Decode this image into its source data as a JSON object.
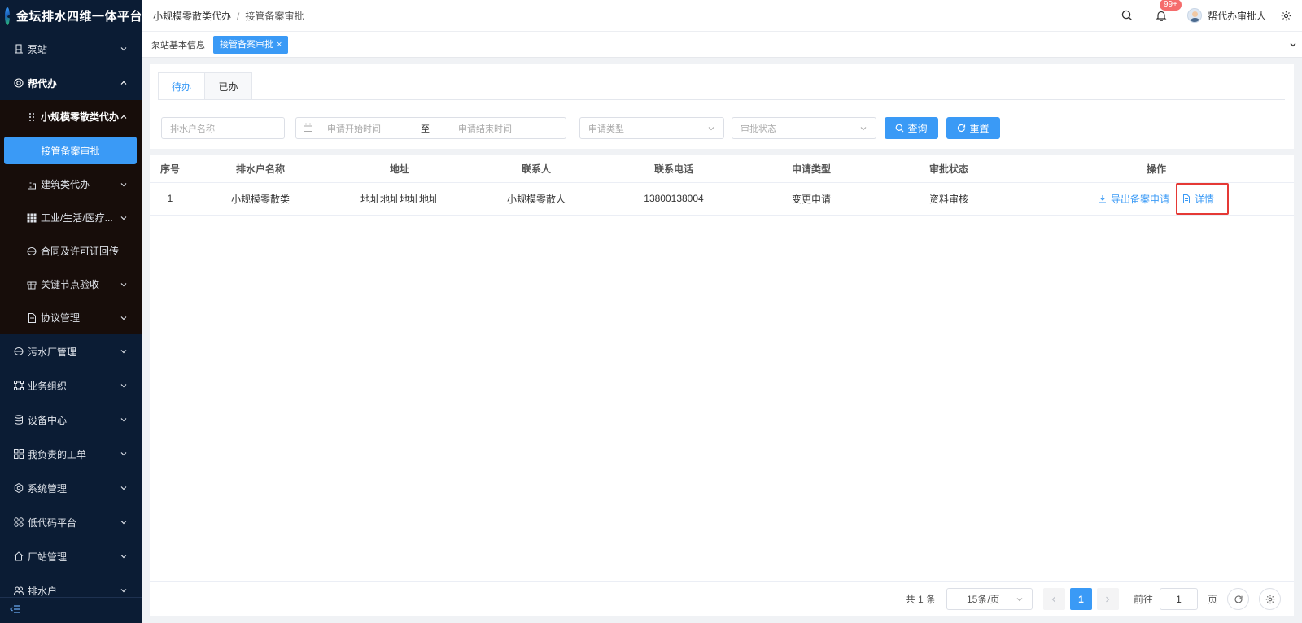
{
  "app": {
    "title": "金坛排水四维一体平台"
  },
  "colors": {
    "sidebar_bg": "#0b1c34",
    "submenu_bg": "#170d0a",
    "accent": "#3a9af6",
    "badge": "#f56c6c",
    "highlight_border": "#e53935"
  },
  "sidebar": {
    "items": [
      {
        "label": "泵站",
        "icon": "building-icon"
      },
      {
        "label": "帮代办",
        "icon": "lifebuoy-icon",
        "open": true
      },
      {
        "label": "污水厂管理",
        "icon": "factory-icon"
      },
      {
        "label": "业务组织",
        "icon": "org-icon"
      },
      {
        "label": "设备中心",
        "icon": "database-icon"
      },
      {
        "label": "我负责的工单",
        "icon": "grid-icon"
      },
      {
        "label": "系统管理",
        "icon": "hexagon-gear-icon"
      },
      {
        "label": "低代码平台",
        "icon": "apps-icon"
      },
      {
        "label": "厂站管理",
        "icon": "home-icon"
      },
      {
        "label": "排水户",
        "icon": "people-icon"
      }
    ],
    "submenu": {
      "group_label": "小规模零散类代办",
      "active_leaf": "接管备案审批",
      "items": [
        {
          "label": "建筑类代办",
          "icon": "building2-icon"
        },
        {
          "label": "工业/生活/医疗...",
          "icon": "grid9-icon"
        },
        {
          "label": "合同及许可证回传",
          "icon": "disk-icon"
        },
        {
          "label": "关键节点验收",
          "icon": "box-icon"
        },
        {
          "label": "协议管理",
          "icon": "doc-icon"
        }
      ]
    }
  },
  "topbar": {
    "breadcrumb": [
      "小规模零散类代办",
      "接管备案审批"
    ],
    "badge": "99+",
    "user": "帮代办审批人"
  },
  "tags": {
    "items": [
      "泵站基本信息",
      "接管备案审批"
    ],
    "close": "×"
  },
  "tabs": [
    "待办",
    "已办"
  ],
  "filters": {
    "name_placeholder": "排水户名称",
    "start_placeholder": "申请开始时间",
    "range_sep": "至",
    "end_placeholder": "申请结束时间",
    "type_placeholder": "申请类型",
    "status_placeholder": "审批状态",
    "query": "查询",
    "reset": "重置"
  },
  "table": {
    "columns": [
      "序号",
      "排水户名称",
      "地址",
      "联系人",
      "联系电话",
      "申请类型",
      "审批状态",
      "操作"
    ],
    "rows": [
      {
        "index": "1",
        "name": "小规模零散类",
        "address": "地址地址地址地址",
        "contact": "小规模零散人",
        "phone": "13800138004",
        "type": "变更申请",
        "status": "资料审核",
        "action_export": "导出备案申请",
        "action_detail": "详情"
      }
    ]
  },
  "pagination": {
    "total": "共 1 条",
    "page_size": "15条/页",
    "current": "1",
    "goto_label": "前往",
    "goto_value": "1",
    "page_unit": "页"
  }
}
